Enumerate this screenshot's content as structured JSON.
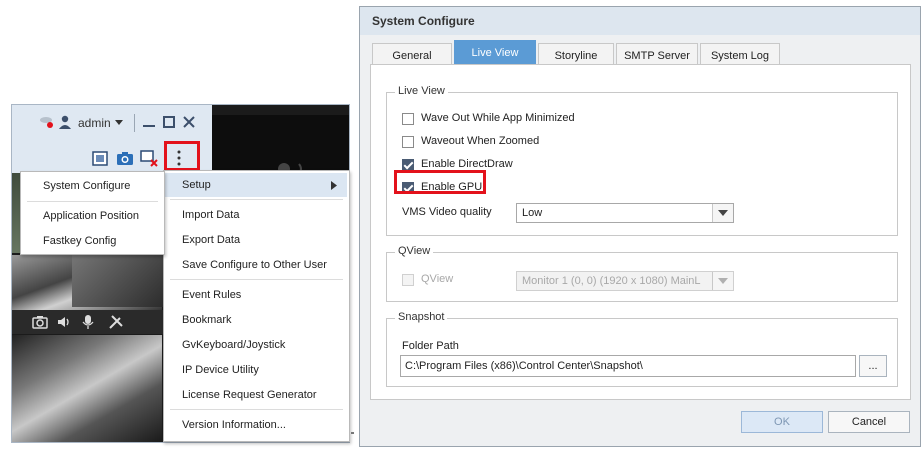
{
  "left": {
    "user_name": "admin",
    "setup_menu": {
      "items": [
        "Setup",
        "Import Data",
        "Export Data",
        "Save Configure to Other User",
        "Event Rules",
        "Bookmark",
        "GvKeyboard/Joystick",
        "IP Device Utility",
        "License Request Generator",
        "Version Information..."
      ]
    },
    "submenu": {
      "items": [
        "System Configure",
        "Application Position",
        "Fastkey Config"
      ]
    },
    "icons": {
      "user_status": "user-offline-icon",
      "user": "user-icon",
      "dropdown": "caret-down-icon",
      "minimize": "minimize-icon",
      "maximize": "maximize-icon",
      "close": "close-icon",
      "layout": "layout-icon",
      "snapshot": "camera-icon",
      "disconnect": "disconnect-icon",
      "more": "more-vertical-icon",
      "submenu_arrow": "chevron-right-icon"
    }
  },
  "dialog": {
    "title": "System Configure",
    "tabs": [
      {
        "label": "General",
        "active": false
      },
      {
        "label": "Live View",
        "active": true
      },
      {
        "label": "Storyline",
        "active": false
      },
      {
        "label": "SMTP Server",
        "active": false
      },
      {
        "label": "System Log",
        "active": false
      }
    ],
    "live_view": {
      "group_label": "Live View",
      "options": [
        {
          "label": "Wave Out While App Minimized",
          "checked": false
        },
        {
          "label": "Waveout When Zoomed",
          "checked": false
        },
        {
          "label": "Enable DirectDraw",
          "checked": true
        },
        {
          "label": "Enable GPU",
          "checked": true
        }
      ],
      "quality_label": "VMS Video quality",
      "quality_value": "Low"
    },
    "qview": {
      "group_label": "QView",
      "option_label": "QView",
      "option_checked": false,
      "monitor_value": "Monitor 1    (0, 0) (1920 x 1080) MainL"
    },
    "snapshot": {
      "group_label": "Snapshot",
      "folder_label": "Folder Path",
      "folder_value": "C:\\Program Files (x86)\\Control Center\\Snapshot\\",
      "browse_label": "..."
    },
    "ok_label": "OK",
    "cancel_label": "Cancel"
  },
  "colors": {
    "highlight": "#e3111b",
    "active_tab": "#5b9bd5",
    "menu_hover": "#dbe6f2"
  }
}
